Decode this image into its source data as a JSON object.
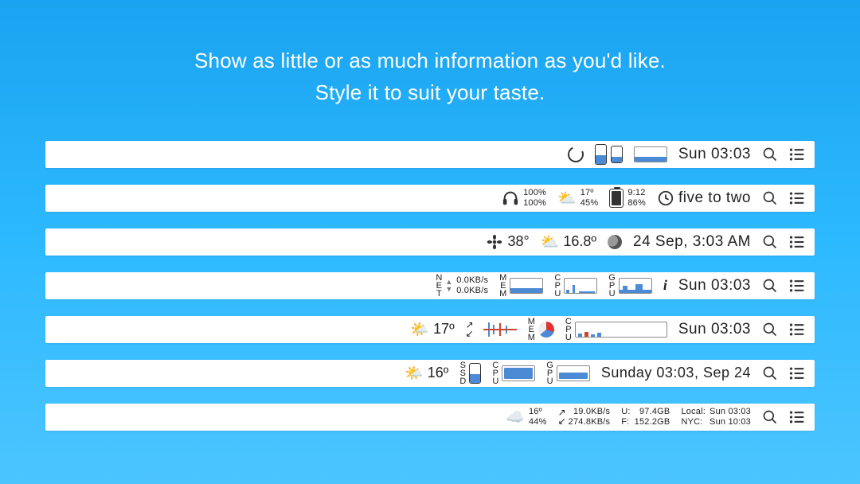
{
  "headline": {
    "line1": "Show as little or as much information as you'd like.",
    "line2": "Style it to suit your taste."
  },
  "bars": [
    {
      "clock": "Sun 03:03"
    },
    {
      "headphones": {
        "top": "100%",
        "bottom": "100%"
      },
      "weather": {
        "temp": "17º",
        "humidity": "45%"
      },
      "battery": {
        "time": "9:12",
        "pct": "86%"
      },
      "clock_text": "five to two"
    },
    {
      "fan_temp": "38°",
      "weather_temp": "16.8º",
      "clock": "24 Sep, 3:03 AM"
    },
    {
      "net": {
        "up": "0.0KB/s",
        "down": "0.0KB/s"
      },
      "labels": {
        "net": "NET",
        "mem": "MEM",
        "cpu": "CPU",
        "gpu": "GPU"
      },
      "clock": "Sun 03:03"
    },
    {
      "weather_temp": "17º",
      "labels": {
        "mem": "MEM",
        "cpu": "CPU"
      },
      "clock": "Sun 03:03"
    },
    {
      "weather_temp": "16º",
      "labels": {
        "ssd": "SSD",
        "cpu": "CPU",
        "gpu": "GPU"
      },
      "clock": "Sunday 03:03, Sep 24"
    },
    {
      "weather": {
        "temp": "16º",
        "humidity": "44%"
      },
      "net": {
        "up": "19.0KB/s",
        "down": "274.8KB/s"
      },
      "disk": {
        "u_label": "U:",
        "u_val": "97.4GB",
        "f_label": "F:",
        "f_val": "152.2GB"
      },
      "clocks": {
        "local_label": "Local:",
        "local": "Sun 03:03",
        "nyc_label": "NYC:",
        "nyc": "Sun 10:03"
      }
    }
  ]
}
